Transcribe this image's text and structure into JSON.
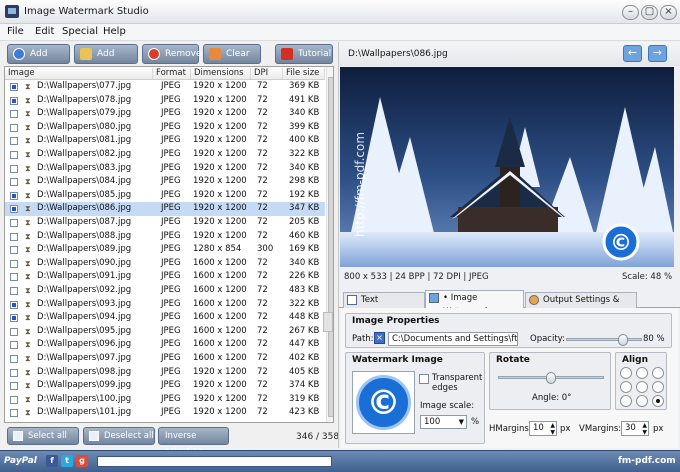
{
  "window": {
    "title": "Image Watermark Studio"
  },
  "menu": [
    "File",
    "Edit",
    "Special",
    "Help"
  ],
  "toolbar": {
    "add_image": "Add image",
    "add_folder": "Add folder",
    "remove": "Remove",
    "clear": "Clear",
    "tutorial": "Tutorial"
  },
  "table": {
    "headers": [
      "Image",
      "Format",
      "Dimensions",
      "DPI",
      "File size"
    ],
    "rows": [
      {
        "name": "D:\\Wallpapers\\077.jpg",
        "format": "JPEG",
        "dim": "1920 x 1200",
        "dpi": "72",
        "size": "369 KB",
        "checked": true
      },
      {
        "name": "D:\\Wallpapers\\078.jpg",
        "format": "JPEG",
        "dim": "1920 x 1200",
        "dpi": "72",
        "size": "491 KB",
        "checked": true
      },
      {
        "name": "D:\\Wallpapers\\079.jpg",
        "format": "JPEG",
        "dim": "1920 x 1200",
        "dpi": "72",
        "size": "340 KB",
        "checked": false
      },
      {
        "name": "D:\\Wallpapers\\080.jpg",
        "format": "JPEG",
        "dim": "1920 x 1200",
        "dpi": "72",
        "size": "399 KB",
        "checked": false
      },
      {
        "name": "D:\\Wallpapers\\081.jpg",
        "format": "JPEG",
        "dim": "1920 x 1200",
        "dpi": "72",
        "size": "400 KB",
        "checked": false
      },
      {
        "name": "D:\\Wallpapers\\082.jpg",
        "format": "JPEG",
        "dim": "1920 x 1200",
        "dpi": "72",
        "size": "322 KB",
        "checked": false
      },
      {
        "name": "D:\\Wallpapers\\083.jpg",
        "format": "JPEG",
        "dim": "1920 x 1200",
        "dpi": "72",
        "size": "340 KB",
        "checked": false
      },
      {
        "name": "D:\\Wallpapers\\084.jpg",
        "format": "JPEG",
        "dim": "1920 x 1200",
        "dpi": "72",
        "size": "298 KB",
        "checked": false
      },
      {
        "name": "D:\\Wallpapers\\085.jpg",
        "format": "JPEG",
        "dim": "1920 x 1200",
        "dpi": "72",
        "size": "192 KB",
        "checked": true
      },
      {
        "name": "D:\\Wallpapers\\086.jpg",
        "format": "JPEG",
        "dim": "1920 x 1200",
        "dpi": "72",
        "size": "347 KB",
        "checked": true
      },
      {
        "name": "D:\\Wallpapers\\087.jpg",
        "format": "JPEG",
        "dim": "1920 x 1200",
        "dpi": "72",
        "size": "205 KB",
        "checked": false
      },
      {
        "name": "D:\\Wallpapers\\088.jpg",
        "format": "JPEG",
        "dim": "1920 x 1200",
        "dpi": "72",
        "size": "460 KB",
        "checked": false
      },
      {
        "name": "D:\\Wallpapers\\089.jpg",
        "format": "JPEG",
        "dim": "1280 x 854",
        "dpi": "300",
        "size": "169 KB",
        "checked": false
      },
      {
        "name": "D:\\Wallpapers\\090.jpg",
        "format": "JPEG",
        "dim": "1600 x 1200",
        "dpi": "72",
        "size": "340 KB",
        "checked": false
      },
      {
        "name": "D:\\Wallpapers\\091.jpg",
        "format": "JPEG",
        "dim": "1600 x 1200",
        "dpi": "72",
        "size": "226 KB",
        "checked": false
      },
      {
        "name": "D:\\Wallpapers\\092.jpg",
        "format": "JPEG",
        "dim": "1600 x 1200",
        "dpi": "72",
        "size": "483 KB",
        "checked": false
      },
      {
        "name": "D:\\Wallpapers\\093.jpg",
        "format": "JPEG",
        "dim": "1600 x 1200",
        "dpi": "72",
        "size": "322 KB",
        "checked": true
      },
      {
        "name": "D:\\Wallpapers\\094.jpg",
        "format": "JPEG",
        "dim": "1600 x 1200",
        "dpi": "72",
        "size": "448 KB",
        "checked": true
      },
      {
        "name": "D:\\Wallpapers\\095.jpg",
        "format": "JPEG",
        "dim": "1600 x 1200",
        "dpi": "72",
        "size": "267 KB",
        "checked": false
      },
      {
        "name": "D:\\Wallpapers\\096.jpg",
        "format": "JPEG",
        "dim": "1600 x 1200",
        "dpi": "72",
        "size": "447 KB",
        "checked": false
      },
      {
        "name": "D:\\Wallpapers\\097.jpg",
        "format": "JPEG",
        "dim": "1600 x 1200",
        "dpi": "72",
        "size": "402 KB",
        "checked": false
      },
      {
        "name": "D:\\Wallpapers\\098.jpg",
        "format": "JPEG",
        "dim": "1920 x 1200",
        "dpi": "72",
        "size": "405 KB",
        "checked": false
      },
      {
        "name": "D:\\Wallpapers\\099.jpg",
        "format": "JPEG",
        "dim": "1920 x 1200",
        "dpi": "72",
        "size": "374 KB",
        "checked": false
      },
      {
        "name": "D:\\Wallpapers\\100.jpg",
        "format": "JPEG",
        "dim": "1920 x 1200",
        "dpi": "72",
        "size": "319 KB",
        "checked": false
      },
      {
        "name": "D:\\Wallpapers\\101.jpg",
        "format": "JPEG",
        "dim": "1920 x 1200",
        "dpi": "72",
        "size": "423 KB",
        "checked": false
      }
    ],
    "selected_index": 9
  },
  "bottom": {
    "select_all": "Select all",
    "deselect_all": "Deselect all",
    "inverse": "Inverse selection",
    "count": "346 / 358"
  },
  "preview": {
    "path": "D:\\Wallpapers\\086.jpg",
    "watermark_text": "http://fm-pdf.com",
    "info": "800 x 533  |  24 BPP  |  72 DPI  |  JPEG",
    "scale": "Scale: 48 %"
  },
  "tabs": {
    "text": "Text Watermark",
    "image": "• Image Watermark",
    "output": "Output Settings & Start"
  },
  "props": {
    "title": "Image Properties",
    "path_label": "Path:",
    "path_value": "C:\\Documents and Settings\\ft",
    "opacity_label": "Opacity:",
    "opacity_value": "80 %",
    "opacity_fraction": 0.8
  },
  "wm_image": {
    "title": "Watermark Image",
    "transparent_label": "Transparent edges",
    "scale_label": "Image scale:",
    "scale_value": "100",
    "percent": "%"
  },
  "rotate": {
    "title": "Rotate",
    "angle_label": "Angle: 0°",
    "angle": 0
  },
  "align": {
    "title": "Align",
    "selected": "bottom-right"
  },
  "margins": {
    "h_label": "HMargins:",
    "h_value": "10",
    "v_label": "VMargins:",
    "v_value": "30",
    "px": "px"
  },
  "status": {
    "paypal": "PayPal",
    "site": "fm-pdf.com"
  },
  "colors": {
    "toolbar_button": "#8a9bb4",
    "selection": "#c5daf5",
    "statusbar": "#4f6f9d",
    "watermark_blue": "#1a6fd6"
  }
}
